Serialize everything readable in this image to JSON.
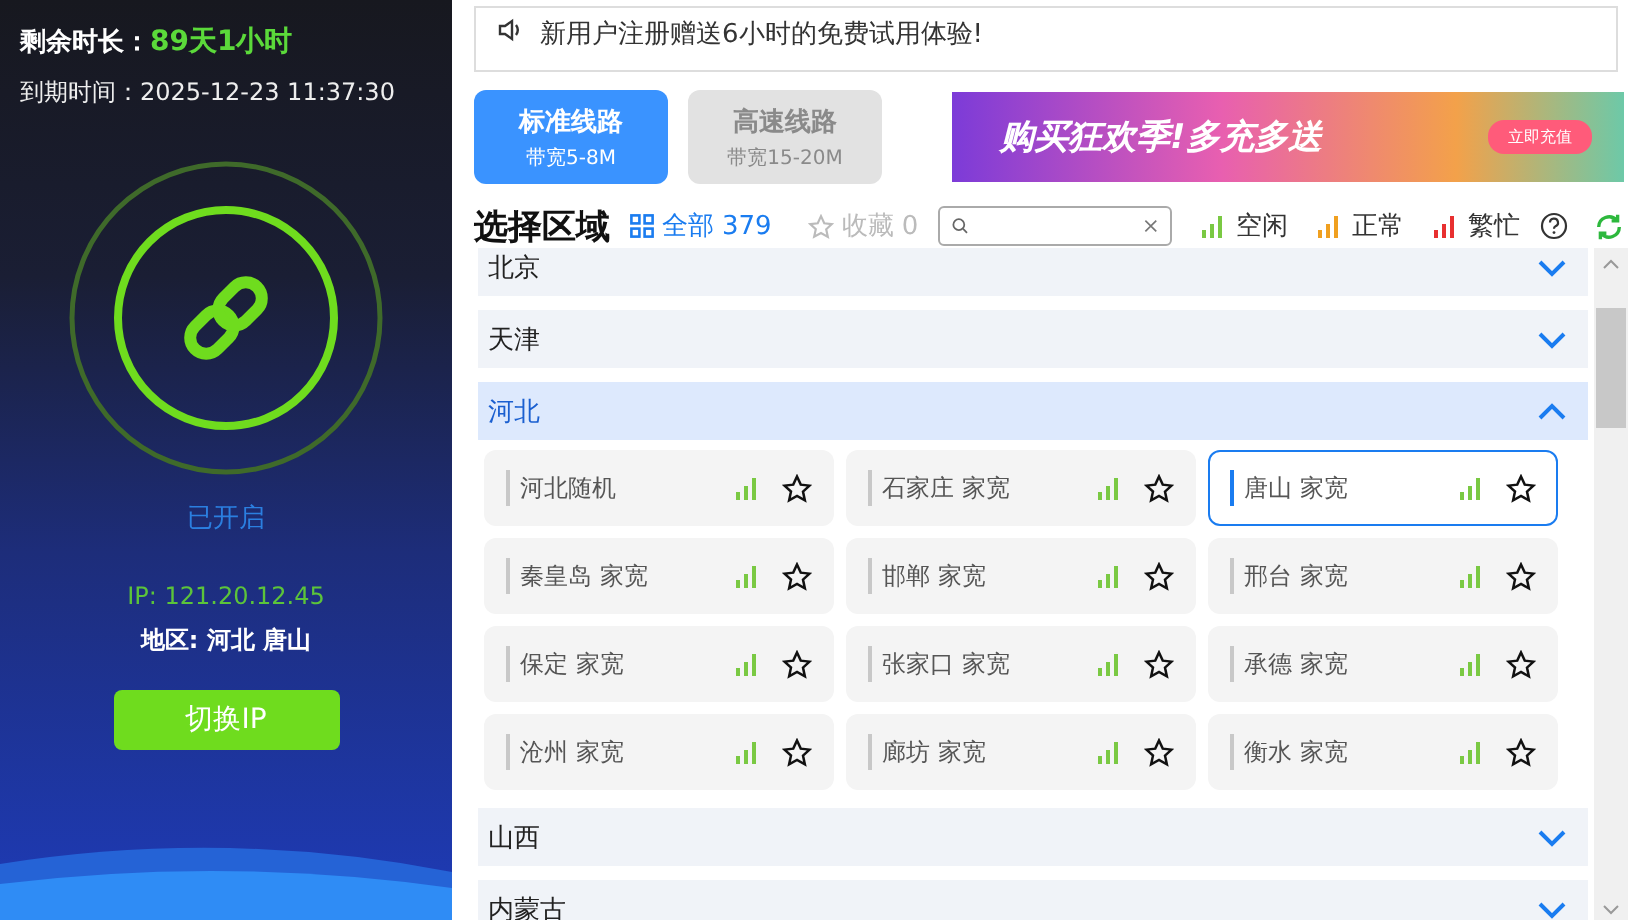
{
  "account": {
    "remaining_label": "剩余时长：",
    "remaining_value": "89天1小时",
    "expiry_label": "到期时间：",
    "expiry_value": "2025-12-23 11:37:30"
  },
  "connection": {
    "on": true,
    "status": "已开启",
    "ip": "IP: 121.20.12.45",
    "region": "地区: 河北 唐山",
    "switch_button": "切换IP"
  },
  "notice": "新用户注册赠送6小时的免费试用体验!",
  "routes": [
    {
      "name": "标准线路",
      "bandwidth": "带宽5-8M",
      "selected": true
    },
    {
      "name": "高速线路",
      "bandwidth": "带宽15-20M",
      "selected": false
    }
  ],
  "banner": {
    "headline": "购买狂欢季!多充多送",
    "button": "立即充值"
  },
  "toolbar": {
    "title": "选择区域",
    "all_label": "全部",
    "all_count": "379",
    "favorites_label": "收藏",
    "favorites_count": "0",
    "legend": [
      {
        "label": "空闲",
        "color": "#7ac943"
      },
      {
        "label": "正常",
        "color": "#f0a020"
      },
      {
        "label": "繁忙",
        "color": "#e83030"
      }
    ]
  },
  "regions": [
    {
      "name": "北京",
      "expanded": false,
      "selected": false
    },
    {
      "name": "天津",
      "expanded": false,
      "selected": false
    },
    {
      "name": "河北",
      "expanded": true,
      "selected": true,
      "items": [
        {
          "name": "河北随机",
          "color": "#7ac943",
          "favorite": false,
          "selected": false
        },
        {
          "name": "石家庄 家宽",
          "color": "#7ac943",
          "favorite": false,
          "selected": false
        },
        {
          "name": "唐山 家宽",
          "color": "#7ac943",
          "favorite": false,
          "selected": true
        },
        {
          "name": "秦皇岛 家宽",
          "color": "#7ac943",
          "favorite": false,
          "selected": false
        },
        {
          "name": "邯郸 家宽",
          "color": "#7ac943",
          "favorite": false,
          "selected": false
        },
        {
          "name": "邢台 家宽",
          "color": "#7ac943",
          "favorite": false,
          "selected": false
        },
        {
          "name": "保定 家宽",
          "color": "#7ac943",
          "favorite": false,
          "selected": false
        },
        {
          "name": "张家口 家宽",
          "color": "#7ac943",
          "favorite": false,
          "selected": false
        },
        {
          "name": "承德 家宽",
          "color": "#7ac943",
          "favorite": false,
          "selected": false
        },
        {
          "name": "沧州 家宽",
          "color": "#7ac943",
          "favorite": false,
          "selected": false
        },
        {
          "name": "廊坊 家宽",
          "color": "#7ac943",
          "favorite": false,
          "selected": false
        },
        {
          "name": "衡水 家宽",
          "color": "#7ac943",
          "favorite": false,
          "selected": false
        }
      ]
    },
    {
      "name": "山西",
      "expanded": false,
      "selected": false
    },
    {
      "name": "内蒙古",
      "expanded": false,
      "selected": false
    }
  ]
}
